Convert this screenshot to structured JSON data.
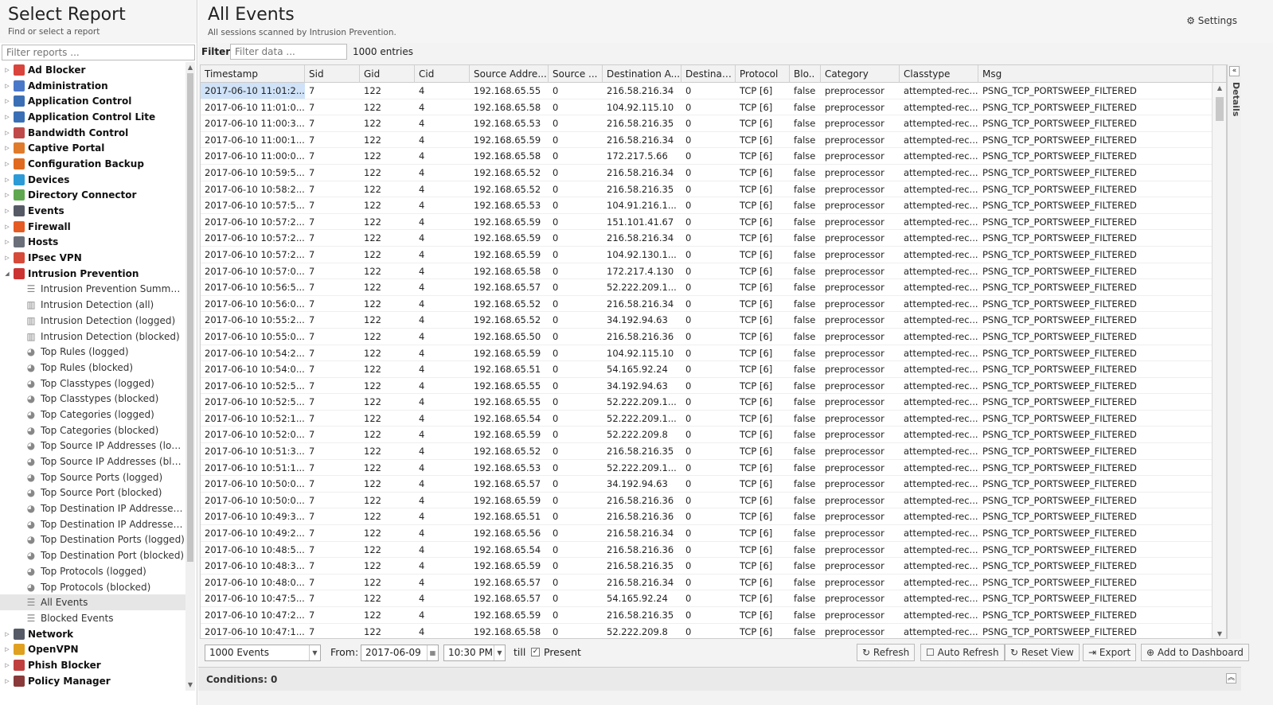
{
  "sidebar": {
    "title": "Select Report",
    "subtitle": "Find or select a report",
    "filter_placeholder": "Filter reports ...",
    "folders": [
      {
        "label": "Ad Blocker",
        "color": "#d9443c"
      },
      {
        "label": "Administration",
        "color": "#4a78c8"
      },
      {
        "label": "Application Control",
        "color": "#3b6fb5"
      },
      {
        "label": "Application Control Lite",
        "color": "#3b6fb5"
      },
      {
        "label": "Bandwidth Control",
        "color": "#c04a4a"
      },
      {
        "label": "Captive Portal",
        "color": "#e07b2c"
      },
      {
        "label": "Configuration Backup",
        "color": "#e06a1f"
      },
      {
        "label": "Devices",
        "color": "#2c9bd6"
      },
      {
        "label": "Directory Connector",
        "color": "#5fa84f"
      },
      {
        "label": "Events",
        "color": "#555a66"
      },
      {
        "label": "Firewall",
        "color": "#e45b24"
      },
      {
        "label": "Hosts",
        "color": "#6a6f7a"
      },
      {
        "label": "IPsec VPN",
        "color": "#d64a3a"
      }
    ],
    "open_folder": {
      "label": "Intrusion Prevention",
      "color": "#cc3333"
    },
    "children": [
      {
        "label": "Intrusion Prevention Summary",
        "icon": "list-icon"
      },
      {
        "label": "Intrusion Detection (all)",
        "icon": "bar-chart-icon"
      },
      {
        "label": "Intrusion Detection (logged)",
        "icon": "bar-chart-icon"
      },
      {
        "label": "Intrusion Detection (blocked)",
        "icon": "bar-chart-icon"
      },
      {
        "label": "Top Rules (logged)",
        "icon": "pie-chart-icon"
      },
      {
        "label": "Top Rules (blocked)",
        "icon": "pie-chart-icon"
      },
      {
        "label": "Top Classtypes (logged)",
        "icon": "pie-chart-icon"
      },
      {
        "label": "Top Classtypes (blocked)",
        "icon": "pie-chart-icon"
      },
      {
        "label": "Top Categories (logged)",
        "icon": "pie-chart-icon"
      },
      {
        "label": "Top Categories (blocked)",
        "icon": "pie-chart-icon"
      },
      {
        "label": "Top Source IP Addresses (logged)",
        "icon": "pie-chart-icon"
      },
      {
        "label": "Top Source IP Addresses (blocked)",
        "icon": "pie-chart-icon"
      },
      {
        "label": "Top Source Ports (logged)",
        "icon": "pie-chart-icon"
      },
      {
        "label": "Top Source Port (blocked)",
        "icon": "pie-chart-icon"
      },
      {
        "label": "Top Destination IP Addresses (lo...",
        "icon": "pie-chart-icon"
      },
      {
        "label": "Top Destination IP Addresses (blo...",
        "icon": "pie-chart-icon"
      },
      {
        "label": "Top Destination Ports (logged)",
        "icon": "pie-chart-icon"
      },
      {
        "label": "Top Destination Port (blocked)",
        "icon": "pie-chart-icon"
      },
      {
        "label": "Top Protocols (logged)",
        "icon": "pie-chart-icon"
      },
      {
        "label": "Top Protocols (blocked)",
        "icon": "pie-chart-icon"
      },
      {
        "label": "All Events",
        "icon": "list-icon",
        "selected": true
      },
      {
        "label": "Blocked Events",
        "icon": "list-icon"
      }
    ],
    "after_folders": [
      {
        "label": "Network",
        "color": "#555a66"
      },
      {
        "label": "OpenVPN",
        "color": "#e0a020"
      },
      {
        "label": "Phish Blocker",
        "color": "#c04040"
      },
      {
        "label": "Policy Manager",
        "color": "#8a3a3a"
      }
    ]
  },
  "header": {
    "title": "All Events",
    "subtitle": "All sessions scanned by Intrusion Prevention.",
    "settings_label": "Settings"
  },
  "filter": {
    "label": "Filter:",
    "placeholder": "Filter data ...",
    "entries": "1000 entries"
  },
  "grid": {
    "columns": [
      "Timestamp",
      "Sid",
      "Gid",
      "Cid",
      "Source Addre...",
      "Source ...",
      "Destination A...",
      "Destinat...",
      "Protocol",
      "Blo..",
      "Category",
      "Classtype",
      "Msg"
    ],
    "rows": [
      [
        "2017-06-10 11:01:2...",
        "7",
        "122",
        "4",
        "192.168.65.55",
        "0",
        "216.58.216.34",
        "0",
        "TCP [6]",
        "false",
        "preprocessor",
        "attempted-rec...",
        "PSNG_TCP_PORTSWEEP_FILTERED"
      ],
      [
        "2017-06-10 11:01:0...",
        "7",
        "122",
        "4",
        "192.168.65.58",
        "0",
        "104.92.115.10",
        "0",
        "TCP [6]",
        "false",
        "preprocessor",
        "attempted-rec...",
        "PSNG_TCP_PORTSWEEP_FILTERED"
      ],
      [
        "2017-06-10 11:00:3...",
        "7",
        "122",
        "4",
        "192.168.65.53",
        "0",
        "216.58.216.35",
        "0",
        "TCP [6]",
        "false",
        "preprocessor",
        "attempted-rec...",
        "PSNG_TCP_PORTSWEEP_FILTERED"
      ],
      [
        "2017-06-10 11:00:1...",
        "7",
        "122",
        "4",
        "192.168.65.59",
        "0",
        "216.58.216.34",
        "0",
        "TCP [6]",
        "false",
        "preprocessor",
        "attempted-rec...",
        "PSNG_TCP_PORTSWEEP_FILTERED"
      ],
      [
        "2017-06-10 11:00:0...",
        "7",
        "122",
        "4",
        "192.168.65.58",
        "0",
        "172.217.5.66",
        "0",
        "TCP [6]",
        "false",
        "preprocessor",
        "attempted-rec...",
        "PSNG_TCP_PORTSWEEP_FILTERED"
      ],
      [
        "2017-06-10 10:59:5...",
        "7",
        "122",
        "4",
        "192.168.65.52",
        "0",
        "216.58.216.34",
        "0",
        "TCP [6]",
        "false",
        "preprocessor",
        "attempted-rec...",
        "PSNG_TCP_PORTSWEEP_FILTERED"
      ],
      [
        "2017-06-10 10:58:2...",
        "7",
        "122",
        "4",
        "192.168.65.52",
        "0",
        "216.58.216.35",
        "0",
        "TCP [6]",
        "false",
        "preprocessor",
        "attempted-rec...",
        "PSNG_TCP_PORTSWEEP_FILTERED"
      ],
      [
        "2017-06-10 10:57:5...",
        "7",
        "122",
        "4",
        "192.168.65.53",
        "0",
        "104.91.216.1...",
        "0",
        "TCP [6]",
        "false",
        "preprocessor",
        "attempted-rec...",
        "PSNG_TCP_PORTSWEEP_FILTERED"
      ],
      [
        "2017-06-10 10:57:2...",
        "7",
        "122",
        "4",
        "192.168.65.59",
        "0",
        "151.101.41.67",
        "0",
        "TCP [6]",
        "false",
        "preprocessor",
        "attempted-rec...",
        "PSNG_TCP_PORTSWEEP_FILTERED"
      ],
      [
        "2017-06-10 10:57:2...",
        "7",
        "122",
        "4",
        "192.168.65.59",
        "0",
        "216.58.216.34",
        "0",
        "TCP [6]",
        "false",
        "preprocessor",
        "attempted-rec...",
        "PSNG_TCP_PORTSWEEP_FILTERED"
      ],
      [
        "2017-06-10 10:57:2...",
        "7",
        "122",
        "4",
        "192.168.65.59",
        "0",
        "104.92.130.1...",
        "0",
        "TCP [6]",
        "false",
        "preprocessor",
        "attempted-rec...",
        "PSNG_TCP_PORTSWEEP_FILTERED"
      ],
      [
        "2017-06-10 10:57:0...",
        "7",
        "122",
        "4",
        "192.168.65.58",
        "0",
        "172.217.4.130",
        "0",
        "TCP [6]",
        "false",
        "preprocessor",
        "attempted-rec...",
        "PSNG_TCP_PORTSWEEP_FILTERED"
      ],
      [
        "2017-06-10 10:56:5...",
        "7",
        "122",
        "4",
        "192.168.65.57",
        "0",
        "52.222.209.1...",
        "0",
        "TCP [6]",
        "false",
        "preprocessor",
        "attempted-rec...",
        "PSNG_TCP_PORTSWEEP_FILTERED"
      ],
      [
        "2017-06-10 10:56:0...",
        "7",
        "122",
        "4",
        "192.168.65.52",
        "0",
        "216.58.216.34",
        "0",
        "TCP [6]",
        "false",
        "preprocessor",
        "attempted-rec...",
        "PSNG_TCP_PORTSWEEP_FILTERED"
      ],
      [
        "2017-06-10 10:55:2...",
        "7",
        "122",
        "4",
        "192.168.65.52",
        "0",
        "34.192.94.63",
        "0",
        "TCP [6]",
        "false",
        "preprocessor",
        "attempted-rec...",
        "PSNG_TCP_PORTSWEEP_FILTERED"
      ],
      [
        "2017-06-10 10:55:0...",
        "7",
        "122",
        "4",
        "192.168.65.50",
        "0",
        "216.58.216.36",
        "0",
        "TCP [6]",
        "false",
        "preprocessor",
        "attempted-rec...",
        "PSNG_TCP_PORTSWEEP_FILTERED"
      ],
      [
        "2017-06-10 10:54:2...",
        "7",
        "122",
        "4",
        "192.168.65.59",
        "0",
        "104.92.115.10",
        "0",
        "TCP [6]",
        "false",
        "preprocessor",
        "attempted-rec...",
        "PSNG_TCP_PORTSWEEP_FILTERED"
      ],
      [
        "2017-06-10 10:54:0...",
        "7",
        "122",
        "4",
        "192.168.65.51",
        "0",
        "54.165.92.24",
        "0",
        "TCP [6]",
        "false",
        "preprocessor",
        "attempted-rec...",
        "PSNG_TCP_PORTSWEEP_FILTERED"
      ],
      [
        "2017-06-10 10:52:5...",
        "7",
        "122",
        "4",
        "192.168.65.55",
        "0",
        "34.192.94.63",
        "0",
        "TCP [6]",
        "false",
        "preprocessor",
        "attempted-rec...",
        "PSNG_TCP_PORTSWEEP_FILTERED"
      ],
      [
        "2017-06-10 10:52:5...",
        "7",
        "122",
        "4",
        "192.168.65.55",
        "0",
        "52.222.209.1...",
        "0",
        "TCP [6]",
        "false",
        "preprocessor",
        "attempted-rec...",
        "PSNG_TCP_PORTSWEEP_FILTERED"
      ],
      [
        "2017-06-10 10:52:1...",
        "7",
        "122",
        "4",
        "192.168.65.54",
        "0",
        "52.222.209.1...",
        "0",
        "TCP [6]",
        "false",
        "preprocessor",
        "attempted-rec...",
        "PSNG_TCP_PORTSWEEP_FILTERED"
      ],
      [
        "2017-06-10 10:52:0...",
        "7",
        "122",
        "4",
        "192.168.65.59",
        "0",
        "52.222.209.8",
        "0",
        "TCP [6]",
        "false",
        "preprocessor",
        "attempted-rec...",
        "PSNG_TCP_PORTSWEEP_FILTERED"
      ],
      [
        "2017-06-10 10:51:3...",
        "7",
        "122",
        "4",
        "192.168.65.52",
        "0",
        "216.58.216.35",
        "0",
        "TCP [6]",
        "false",
        "preprocessor",
        "attempted-rec...",
        "PSNG_TCP_PORTSWEEP_FILTERED"
      ],
      [
        "2017-06-10 10:51:1...",
        "7",
        "122",
        "4",
        "192.168.65.53",
        "0",
        "52.222.209.1...",
        "0",
        "TCP [6]",
        "false",
        "preprocessor",
        "attempted-rec...",
        "PSNG_TCP_PORTSWEEP_FILTERED"
      ],
      [
        "2017-06-10 10:50:0...",
        "7",
        "122",
        "4",
        "192.168.65.57",
        "0",
        "34.192.94.63",
        "0",
        "TCP [6]",
        "false",
        "preprocessor",
        "attempted-rec...",
        "PSNG_TCP_PORTSWEEP_FILTERED"
      ],
      [
        "2017-06-10 10:50:0...",
        "7",
        "122",
        "4",
        "192.168.65.59",
        "0",
        "216.58.216.36",
        "0",
        "TCP [6]",
        "false",
        "preprocessor",
        "attempted-rec...",
        "PSNG_TCP_PORTSWEEP_FILTERED"
      ],
      [
        "2017-06-10 10:49:3...",
        "7",
        "122",
        "4",
        "192.168.65.51",
        "0",
        "216.58.216.36",
        "0",
        "TCP [6]",
        "false",
        "preprocessor",
        "attempted-rec...",
        "PSNG_TCP_PORTSWEEP_FILTERED"
      ],
      [
        "2017-06-10 10:49:2...",
        "7",
        "122",
        "4",
        "192.168.65.56",
        "0",
        "216.58.216.34",
        "0",
        "TCP [6]",
        "false",
        "preprocessor",
        "attempted-rec...",
        "PSNG_TCP_PORTSWEEP_FILTERED"
      ],
      [
        "2017-06-10 10:48:5...",
        "7",
        "122",
        "4",
        "192.168.65.54",
        "0",
        "216.58.216.36",
        "0",
        "TCP [6]",
        "false",
        "preprocessor",
        "attempted-rec...",
        "PSNG_TCP_PORTSWEEP_FILTERED"
      ],
      [
        "2017-06-10 10:48:3...",
        "7",
        "122",
        "4",
        "192.168.65.59",
        "0",
        "216.58.216.35",
        "0",
        "TCP [6]",
        "false",
        "preprocessor",
        "attempted-rec...",
        "PSNG_TCP_PORTSWEEP_FILTERED"
      ],
      [
        "2017-06-10 10:48:0...",
        "7",
        "122",
        "4",
        "192.168.65.57",
        "0",
        "216.58.216.34",
        "0",
        "TCP [6]",
        "false",
        "preprocessor",
        "attempted-rec...",
        "PSNG_TCP_PORTSWEEP_FILTERED"
      ],
      [
        "2017-06-10 10:47:5...",
        "7",
        "122",
        "4",
        "192.168.65.57",
        "0",
        "54.165.92.24",
        "0",
        "TCP [6]",
        "false",
        "preprocessor",
        "attempted-rec...",
        "PSNG_TCP_PORTSWEEP_FILTERED"
      ],
      [
        "2017-06-10 10:47:2...",
        "7",
        "122",
        "4",
        "192.168.65.59",
        "0",
        "216.58.216.35",
        "0",
        "TCP [6]",
        "false",
        "preprocessor",
        "attempted-rec...",
        "PSNG_TCP_PORTSWEEP_FILTERED"
      ],
      [
        "2017-06-10 10:47:1...",
        "7",
        "122",
        "4",
        "192.168.65.58",
        "0",
        "52.222.209.8",
        "0",
        "TCP [6]",
        "false",
        "preprocessor",
        "attempted-rec...",
        "PSNG_TCP_PORTSWEEP_FILTERED"
      ]
    ]
  },
  "details_label": "Details",
  "toolbar": {
    "limit": "1000 Events",
    "from_label": "From:",
    "date": "2017-06-09",
    "time": "10:30 PM",
    "till_label": "till",
    "present_label": "Present",
    "refresh": "Refresh",
    "auto_refresh": "Auto Refresh",
    "reset_view": "Reset View",
    "export": "Export",
    "add_dashboard": "Add to Dashboard"
  },
  "conditions": "Conditions: 0"
}
